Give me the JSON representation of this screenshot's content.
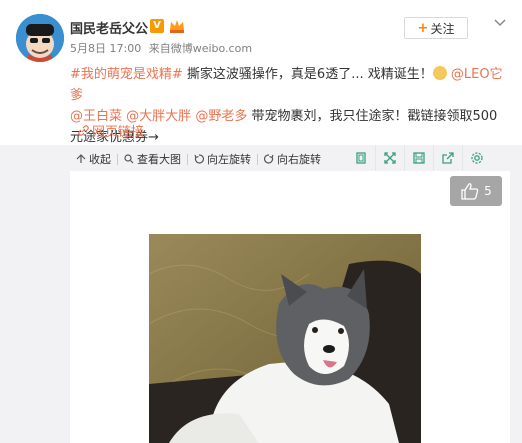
{
  "user": {
    "name": "国民老岳父公",
    "v_badge": "V"
  },
  "meta": {
    "date": "5月8日 17:00",
    "source_prefix": "来自",
    "source": "微博weibo.com"
  },
  "follow_button": {
    "label": "关注",
    "plus": "+"
  },
  "post": {
    "hashtag": "#我的萌宠是戏精#",
    "text1": " 撕家这波骚操作，真是6透了... 戏精诞生！",
    "mention1": "@LEO它爹",
    "mention2": "@王白菜",
    "mention3": "@大胖大胖",
    "mention4": "@野老多",
    "text2": " 带宠物裹刘，我只住途家！戳链接领取500元途家优惠券→",
    "link_label": "网页链接"
  },
  "toolbar": {
    "collapse": "收起",
    "view_large": "查看大图",
    "rotate_left": "向左旋转",
    "rotate_right": "向右旋转"
  },
  "icons": [
    "crop-icon",
    "fullscreen-icon",
    "save-icon",
    "share-icon",
    "settings-icon"
  ],
  "like": {
    "count": "5"
  },
  "colors": {
    "accent": "#eb7350",
    "follow_plus": "#ff8200",
    "v_badge": "#f79900",
    "like_bg": "#a6a6a6"
  }
}
